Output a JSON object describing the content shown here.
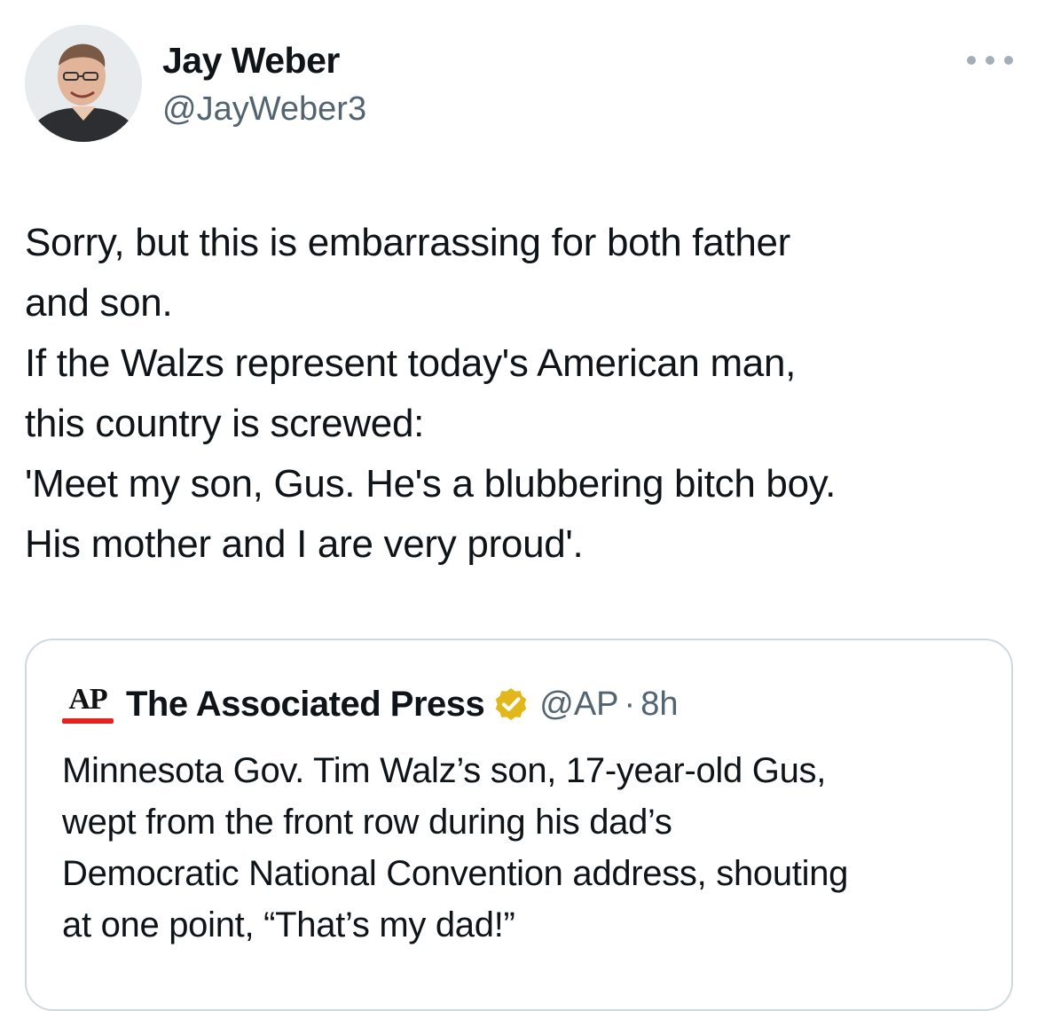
{
  "author": {
    "display_name": "Jay Weber",
    "handle": "@JayWeber3",
    "avatar_icon": "profile-photo"
  },
  "more_icon": "more-options-icon",
  "tweet": {
    "lines": [
      "Sorry, but this is embarrassing for both father",
      "and son.",
      "If the Walzs represent today's American man,",
      "this country is screwed:",
      "'Meet my son, Gus. He's a blubbering bitch boy.",
      "His mother and I are very proud'."
    ]
  },
  "quoted_tweet": {
    "logo_text": "AP",
    "display_name": "The Associated Press",
    "verified_icon": "gold-verified-badge-icon",
    "handle": "@AP",
    "separator": "·",
    "time": "8h",
    "lines": [
      "Minnesota Gov. Tim Walz’s son, 17-year-old Gus,",
      "wept from the front row during his dad’s",
      "Democratic National Convention address, shouting",
      "at one point, “That’s my dad!”"
    ]
  },
  "colors": {
    "text": "#0f1419",
    "secondary_text": "#536471",
    "border": "#cfd9de",
    "verified_gold": "#e2b719",
    "ap_red": "#e4231f"
  }
}
